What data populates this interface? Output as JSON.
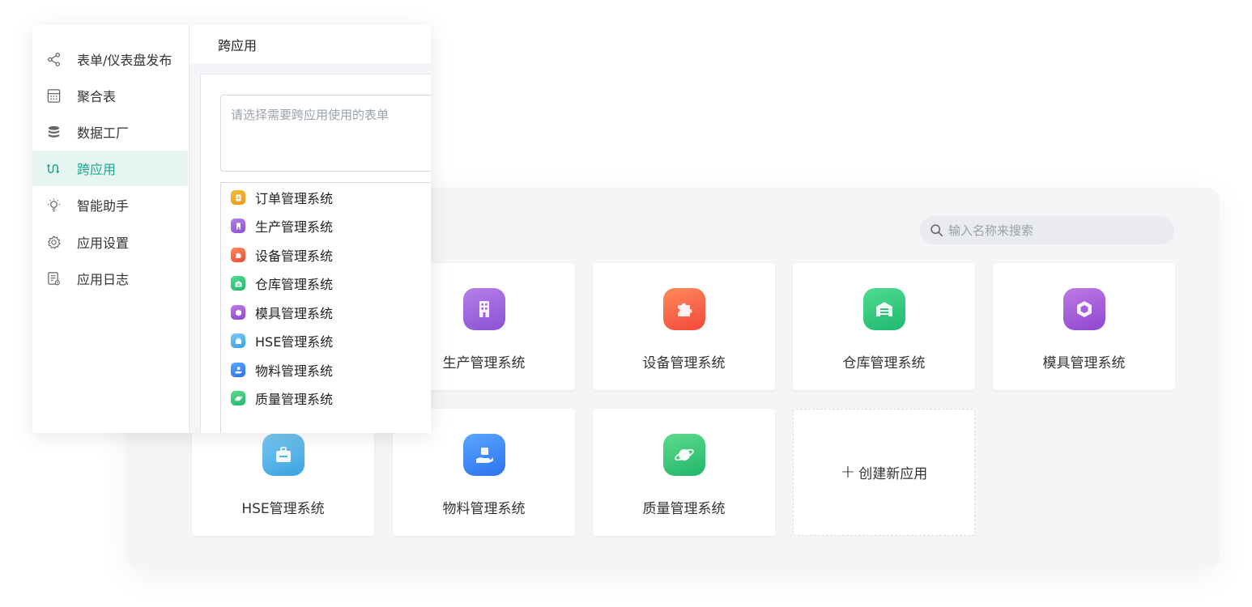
{
  "search": {
    "placeholder": "输入名称来搜索"
  },
  "apps": [
    {
      "id": "order",
      "label": "订单管理系统",
      "icon": "document-icon",
      "color_from": "#f7b93b",
      "color_to": "#ef9a1a"
    },
    {
      "id": "production",
      "label": "生产管理系统",
      "icon": "building-icon",
      "color_from": "#b77ee8",
      "color_to": "#8a52d4"
    },
    {
      "id": "equipment",
      "label": "设备管理系统",
      "icon": "puzzle-icon",
      "color_from": "#ff8a5c",
      "color_to": "#f2483a"
    },
    {
      "id": "warehouse",
      "label": "仓库管理系统",
      "icon": "warehouse-icon",
      "color_from": "#4fdc8f",
      "color_to": "#1fb870"
    },
    {
      "id": "mold",
      "label": "模具管理系统",
      "icon": "cube-icon",
      "color_from": "#c07ae6",
      "color_to": "#8d46cf"
    },
    {
      "id": "hse",
      "label": "HSE管理系统",
      "icon": "briefcase-icon",
      "color_from": "#7cc9f2",
      "color_to": "#3aa2e0"
    },
    {
      "id": "material",
      "label": "物料管理系统",
      "icon": "hand-package-icon",
      "color_from": "#59a6ff",
      "color_to": "#2c72ef"
    },
    {
      "id": "quality",
      "label": "质量管理系统",
      "icon": "planet-icon",
      "color_from": "#5ddc8c",
      "color_to": "#22b56a"
    }
  ],
  "create_app": {
    "plus": "+",
    "label": "创建新应用"
  },
  "sidebar": {
    "items": [
      {
        "label": "表单/仪表盘发布",
        "icon": "share-icon",
        "active": false
      },
      {
        "label": "聚合表",
        "icon": "calculator-icon",
        "active": false
      },
      {
        "label": "数据工厂",
        "icon": "database-icon",
        "active": false
      },
      {
        "label": "跨应用",
        "icon": "cross-app-icon",
        "active": true
      },
      {
        "label": "智能助手",
        "icon": "lightbulb-icon",
        "active": false
      },
      {
        "label": "应用设置",
        "icon": "gear-icon",
        "active": false
      },
      {
        "label": "应用日志",
        "icon": "log-icon",
        "active": false
      }
    ]
  },
  "content": {
    "title": "跨应用",
    "select_placeholder": "请选择需要跨应用使用的表单"
  },
  "colors": {
    "accent": "#1aa593",
    "accent_bg": "#e6f5f2"
  }
}
